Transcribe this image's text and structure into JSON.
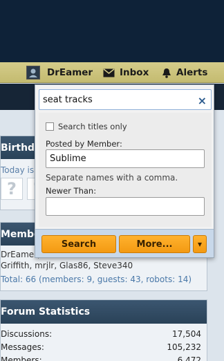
{
  "userbar": {
    "username": "DrEamer",
    "inbox_label": "Inbox",
    "alerts_label": "Alerts"
  },
  "birthday": {
    "title": "Birthda",
    "today_text": "Today is",
    "placeholder_glyph": "?"
  },
  "members": {
    "title": "Membe",
    "line1": "DrEamer,",
    "line2": "Griffith, mrjlr, Glas86, Steve340",
    "total": "Total: 66 (members: 9, guests: 43, robots: 14)"
  },
  "stats": {
    "title": "Forum Statistics",
    "rows": [
      {
        "label": "Discussions:",
        "value": "17,504"
      },
      {
        "label": "Messages:",
        "value": "105,232"
      },
      {
        "label": "Members:",
        "value": "6,472"
      }
    ]
  },
  "search_popup": {
    "query": "seat tracks",
    "close_glyph": "×",
    "titles_only_label": "Search titles only",
    "posted_by_label": "Posted by Member:",
    "posted_by_value": "Sublime",
    "separate_hint": "Separate names with a comma.",
    "newer_than_label": "Newer Than:",
    "newer_than_value": "",
    "search_button": "Search",
    "more_button": "More...",
    "dropdown_glyph": "▾"
  }
}
